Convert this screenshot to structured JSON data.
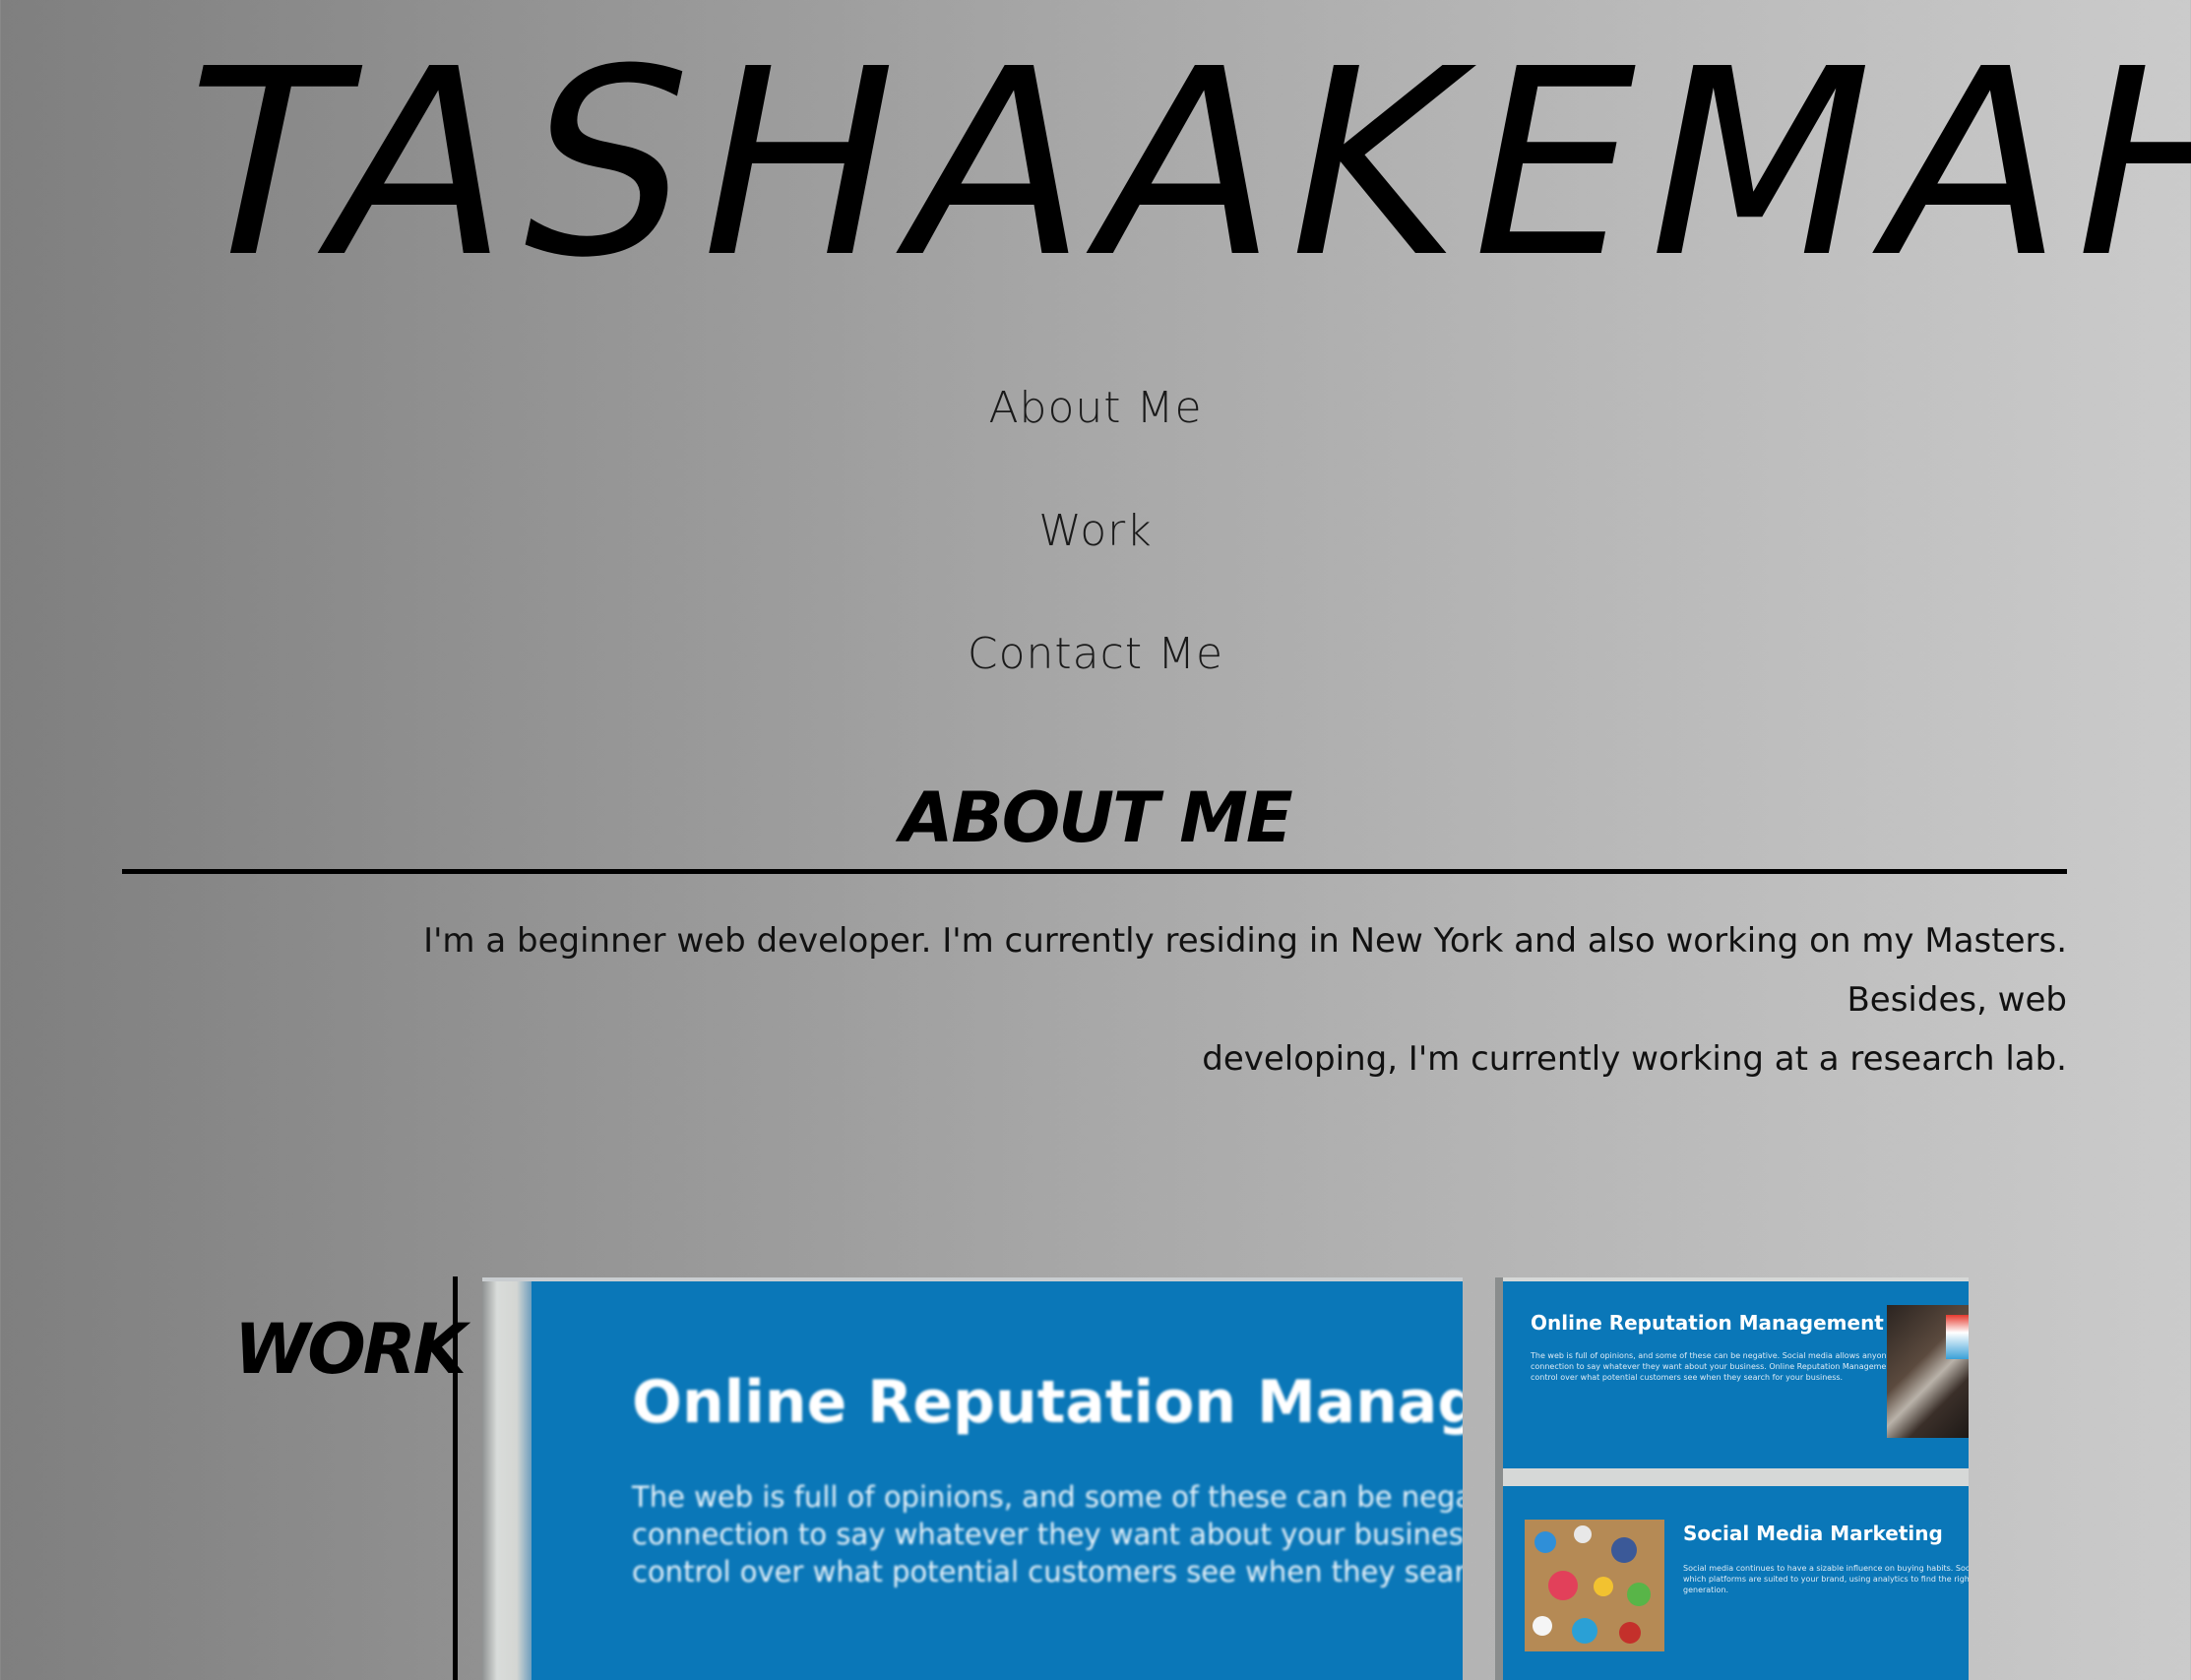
{
  "header": {
    "logo_mirrored_part": "TAS",
    "logo_main_part": "HAAKEMAH"
  },
  "nav": {
    "items": [
      {
        "label": "About Me"
      },
      {
        "label": "Work"
      },
      {
        "label": "Contact Me"
      }
    ]
  },
  "about": {
    "title": "ABOUT ME",
    "text_line1": "I'm a beginner web developer. I'm currently residing in New York and also working on my Masters. Besides, web",
    "text_line2": "developing, I'm currently working at a research lab."
  },
  "work": {
    "title": "WORK",
    "main_thumbnail": {
      "heading": "Online Reputation Management",
      "body_line1": "The web is full of opinions, and some of these can be negative. Social media allows anyone with an internet",
      "body_line2": "connection to say whatever they want about your business. Online Reputation Management gives you the",
      "body_line3": "control over what potential customers see when they search for your business."
    },
    "side_thumbnail": {
      "card1_title": "Online Reputation Management",
      "card1_text_line1": "The web is full of opinions, and some of these can be negative. Social media allows anyone with an internet",
      "card1_text_line2": "connection to say whatever they want about your business. Online Reputation Management gives you the",
      "card1_text_line3": "control over what potential customers see when they search for your business.",
      "card2_title": "Social Media Marketing",
      "card2_text_line1": "Social media continues to have a sizable influence on buying habits. Social media marketing finds",
      "card2_text_line2": "which platforms are suited to your brand, using analytics to find the right markets and increase",
      "card2_text_line3": "generation."
    }
  },
  "colors": {
    "thumbnail_blue": "#0a77b8",
    "text": "#000000",
    "background_left": "#7f7f7f",
    "background_right": "#cbcbcb"
  }
}
